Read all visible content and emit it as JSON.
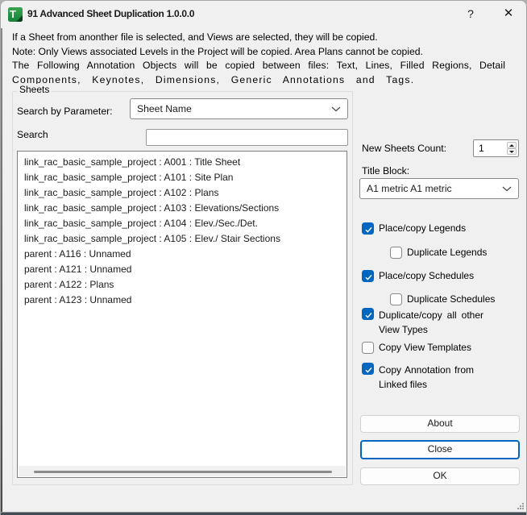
{
  "window": {
    "title": "91 Advanced Sheet Duplication 1.0.0.0",
    "help_label": "?",
    "close_label": "✕"
  },
  "intro": {
    "lines": [
      "If a Sheet from anonther file is selected, and Views are selected, they will be copied.",
      "Note: Only Views associated Levels in the Project will be copied. Area Plans cannot be copied.",
      "The Following Annotation Objects will be copied between files: Text, Lines, Filled Regions, Detail",
      "Components, Keynotes, Dimensions, Generic Annotations and Tags."
    ]
  },
  "sheets_group": {
    "label": "Sheets",
    "search_by_parameter_label": "Search by Parameter:",
    "parameter_value": "Sheet Name",
    "search_label": "Search",
    "search_value": "",
    "items": [
      "link_rac_basic_sample_project : A001 : Title Sheet",
      "link_rac_basic_sample_project : A101 : Site Plan",
      "link_rac_basic_sample_project : A102 : Plans",
      "link_rac_basic_sample_project : A103 : Elevations/Sections",
      "link_rac_basic_sample_project : A104 : Elev./Sec./Det.",
      "link_rac_basic_sample_project : A105 : Elev./ Stair Sections",
      "parent : A116 : Unnamed",
      "parent : A121 : Unnamed",
      "parent : A122 : Plans",
      "parent : A123 : Unnamed"
    ]
  },
  "right_panel": {
    "new_sheets_count_label": "New Sheets Count:",
    "new_sheets_count_value": "1",
    "title_block_label": "Title Block:",
    "title_block_value": "A1 metric A1 metric",
    "checkboxes": [
      {
        "label": "Place/copy Legends",
        "checked": true
      },
      {
        "label": "Duplicate Legends",
        "checked": false
      },
      {
        "label": "Place/copy Schedules",
        "checked": true
      },
      {
        "label": "Duplicate Schedules",
        "checked": false
      },
      {
        "label": "Duplicate/copy all other View Types",
        "checked": true
      },
      {
        "label": "Copy View Templates",
        "checked": false
      },
      {
        "label": "Copy Annotation from Linked files",
        "checked": true
      }
    ],
    "buttons": {
      "about": "About",
      "close": "Close",
      "ok": "OK"
    }
  },
  "colors": {
    "accent": "#0067c0",
    "icon_green": "#2e9e4a"
  }
}
